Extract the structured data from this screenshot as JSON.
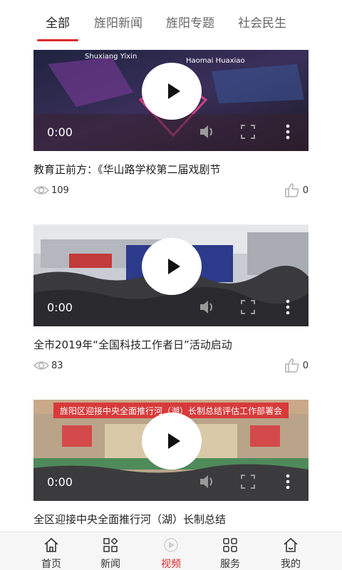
{
  "tabs": [
    {
      "label": "全部",
      "active": true
    },
    {
      "label": "旌阳新闻",
      "active": false
    },
    {
      "label": "旌阳专题",
      "active": false
    },
    {
      "label": "社会民生",
      "active": false
    }
  ],
  "accent_color": "#d92b2b",
  "videos": [
    {
      "time": "0:00",
      "title": "教育正前方：《华山路学校第二届戏剧节",
      "views": "109",
      "likes": "0",
      "thumbnail_overlay": {
        "left_text": "Shuxiang Yixin",
        "right_text": "Haomai Huaxiao"
      }
    },
    {
      "time": "0:00",
      "title": "全市2019年“全国科技工作者日”活动启动",
      "views": "83",
      "likes": "0"
    },
    {
      "time": "0:00",
      "title": "全区迎接中央全面推行河（湖）长制总结",
      "banner": "旌阳区迎接中央全面推行河（湖）长制总结评估工作部署会"
    }
  ],
  "bottom_nav": [
    {
      "label": "首页",
      "icon": "home-icon",
      "active": false
    },
    {
      "label": "新闻",
      "icon": "grid-diamond-icon",
      "active": false
    },
    {
      "label": "视频",
      "icon": "video-icon",
      "active": true
    },
    {
      "label": "服务",
      "icon": "grid-icon",
      "active": false
    },
    {
      "label": "我的",
      "icon": "profile-home-icon",
      "active": false
    }
  ]
}
